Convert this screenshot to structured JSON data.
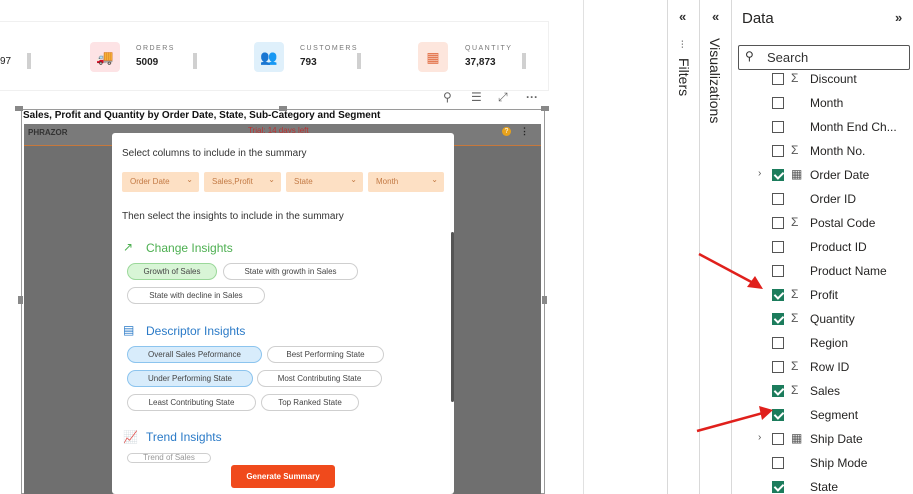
{
  "kpis": {
    "fragment_value": "97",
    "orders": {
      "label": "ORDERS",
      "value": "5009",
      "color": "#fde3e5",
      "icon": "truck-icon"
    },
    "customers": {
      "label": "CUSTOMERS",
      "value": "793",
      "color": "#dff0fb",
      "icon": "people-icon"
    },
    "quantity": {
      "label": "QUANTITY",
      "value": "37,873",
      "color": "#fde6dd",
      "icon": "calculator-icon"
    }
  },
  "visual": {
    "title": "Sales, Profit and Quantity by Order Date, State, Sub-Category and Segment",
    "header_icons": [
      "pin-icon",
      "filter-icon",
      "focus-mode-icon",
      "more-options-icon"
    ]
  },
  "phrazor": {
    "logo": "PHRAZOR",
    "trial": "Trial: 14 days left",
    "help": "?",
    "more": "⋮"
  },
  "modal": {
    "select_columns": "Select columns to include in the summary",
    "dropdowns": [
      "Order Date",
      "Sales,Profit",
      "State",
      "Month"
    ],
    "select_insights": "Then select the insights to include in the summary",
    "sections": [
      {
        "title": "Change Insights",
        "color": "#4caf50",
        "chips": [
          "Growth of Sales",
          "State with growth in Sales",
          "State with decline in Sales"
        ]
      },
      {
        "title": "Descriptor Insights",
        "color": "#2a7ac7",
        "chips": [
          "Overall Sales Peformance",
          "Best Performing State",
          "Under Performing State",
          "Most Contributing State",
          "Least Contributing State",
          "Top Ranked State"
        ]
      },
      {
        "title": "Trend Insights",
        "color": "#2a7ac7",
        "chips": [
          "Trend of Sales"
        ]
      }
    ],
    "generate_button": "Generate Summary"
  },
  "panes": {
    "filters_label": "Filters",
    "visualizations_label": "Visualizations",
    "collapse_glyph": "«",
    "expand_glyph": "»"
  },
  "data_pane": {
    "title": "Data",
    "search_placeholder": "Search",
    "fields": [
      {
        "name": "Discount",
        "checked": false,
        "type": "sum",
        "expandable": false
      },
      {
        "name": "Month",
        "checked": false,
        "type": "",
        "expandable": false
      },
      {
        "name": "Month End Ch...",
        "checked": false,
        "type": "",
        "expandable": false
      },
      {
        "name": "Month No.",
        "checked": false,
        "type": "sum",
        "expandable": false
      },
      {
        "name": "Order Date",
        "checked": true,
        "type": "calendar",
        "expandable": true
      },
      {
        "name": "Order ID",
        "checked": false,
        "type": "",
        "expandable": false
      },
      {
        "name": "Postal Code",
        "checked": false,
        "type": "sum",
        "expandable": false
      },
      {
        "name": "Product ID",
        "checked": false,
        "type": "",
        "expandable": false
      },
      {
        "name": "Product Name",
        "checked": false,
        "type": "",
        "expandable": false
      },
      {
        "name": "Profit",
        "checked": true,
        "type": "sum",
        "expandable": false
      },
      {
        "name": "Quantity",
        "checked": true,
        "type": "sum",
        "expandable": false
      },
      {
        "name": "Region",
        "checked": false,
        "type": "",
        "expandable": false
      },
      {
        "name": "Row ID",
        "checked": false,
        "type": "sum",
        "expandable": false
      },
      {
        "name": "Sales",
        "checked": true,
        "type": "sum",
        "expandable": false
      },
      {
        "name": "Segment",
        "checked": true,
        "type": "",
        "expandable": false
      },
      {
        "name": "Ship Date",
        "checked": false,
        "type": "calendar",
        "expandable": true
      },
      {
        "name": "Ship Mode",
        "checked": false,
        "type": "",
        "expandable": false
      },
      {
        "name": "State",
        "checked": true,
        "type": "",
        "expandable": false
      }
    ]
  },
  "accent_colors": {
    "checkbox": "#1c7c5c",
    "arrow": "#e0201c",
    "generate": "#f04a1c"
  }
}
